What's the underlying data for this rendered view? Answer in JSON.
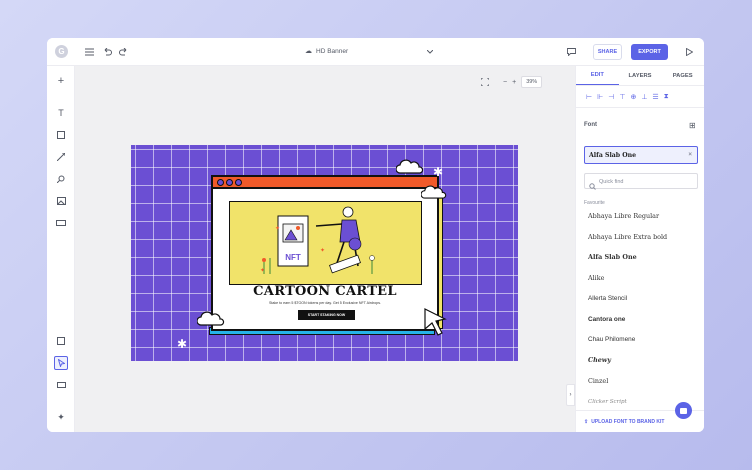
{
  "topbar": {
    "doc_title": "HD Banner"
  },
  "toolbar": {
    "share_label": "SHARE",
    "export_label": "EXPORT"
  },
  "canvas": {
    "zoom": "39%"
  },
  "design": {
    "headline": "CARTOON CARTEL",
    "subline": "Stake to earn 5 $TOON tokens per day. Get 5 Exclusive NFT Airdrops.",
    "cta": "START STAKING NOW",
    "nft_label": "NFT"
  },
  "panel": {
    "tabs": [
      "EDIT",
      "LAYERS",
      "PAGES"
    ],
    "font_label": "Font",
    "selected_font": "Alfa Slab One",
    "quick_find_placeholder": "Quick find",
    "favourite_label": "Favourite",
    "fonts": [
      "Abhaya Libre Regular",
      "Abhaya Libre Extra bold",
      "Alfa Slab One",
      "Alike",
      "Allerta Stencil",
      "Cantora one",
      "Chau Philomene",
      "Chewy",
      "Cinzel",
      "Clicker Script"
    ],
    "upload_label": "UPLOAD FONT TO BRAND KIT"
  },
  "colors": {
    "accent": "#5b63e6",
    "canvas_bg": "#6b4fd3"
  }
}
